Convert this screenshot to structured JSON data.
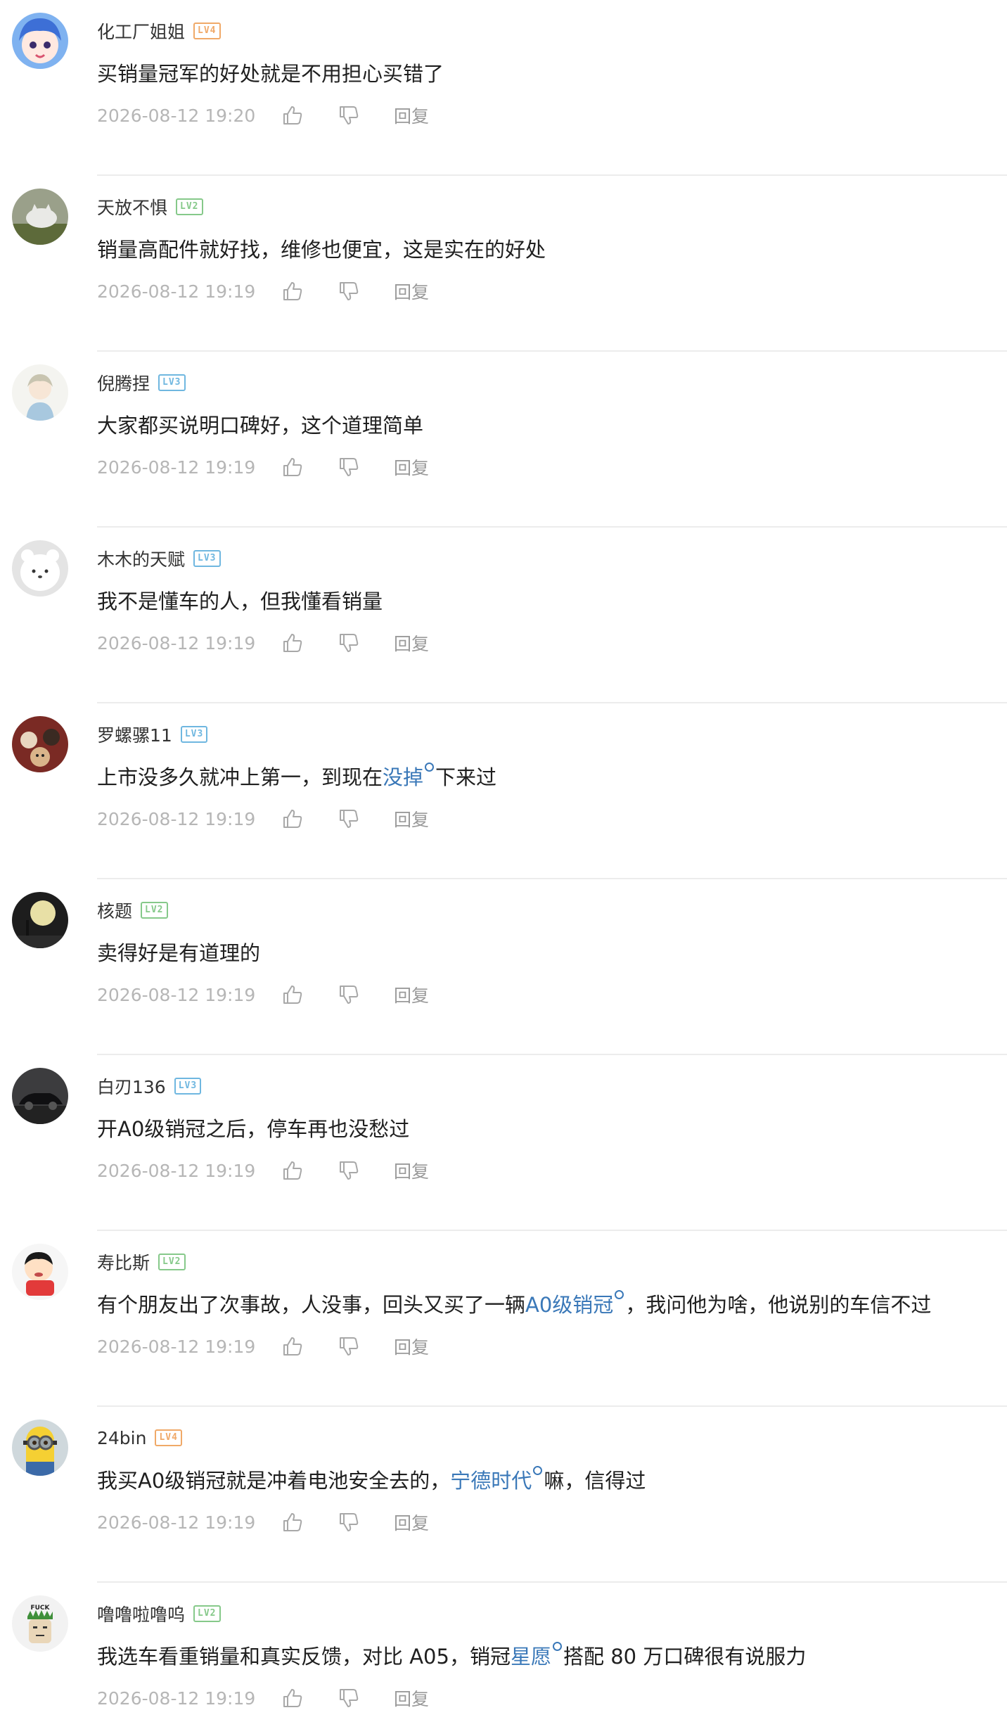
{
  "actions": {
    "reply_label": "回复"
  },
  "colors": {
    "level_orange": "#f0a968",
    "level_green": "#86c98a",
    "level_blue": "#6fb7e0",
    "link": "#3a78b8",
    "meta_gray": "#b6b6b6"
  },
  "comments": [
    {
      "user": "化工厂姐姐",
      "level": "LV4",
      "level_color": "#f0a968",
      "avatar": "anime-girl-avatar",
      "text": [
        "买销量冠军的好处就是不用担心买错了"
      ],
      "time": "2026-08-12 19:20"
    },
    {
      "user": "天放不惧",
      "level": "LV2",
      "level_color": "#86c98a",
      "avatar": "cat-avatar",
      "text": [
        "销量高配件就好找，维修也便宜，这是实在的好处"
      ],
      "time": "2026-08-12 19:19"
    },
    {
      "user": "倪腾捏",
      "level": "LV3",
      "level_color": "#6fb7e0",
      "avatar": "anime-character-avatar",
      "text": [
        "大家都买说明口碑好，这个道理简单"
      ],
      "time": "2026-08-12 19:19"
    },
    {
      "user": "木木的天赋",
      "level": "LV3",
      "level_color": "#6fb7e0",
      "avatar": "white-bear-avatar",
      "text": [
        "我不是懂车的人，但我懂看销量"
      ],
      "time": "2026-08-12 19:19"
    },
    {
      "user": "罗螺骡11",
      "level": "LV3",
      "level_color": "#6fb7e0",
      "avatar": "cats-photo-avatar",
      "text": [
        "上市没多久就冲上第一，到现在",
        "没掉",
        "下来过"
      ],
      "time": "2026-08-12 19:19"
    },
    {
      "user": "核题",
      "level": "LV2",
      "level_color": "#86c98a",
      "avatar": "moon-silhouette-avatar",
      "text": [
        "卖得好是有道理的"
      ],
      "time": "2026-08-12 19:19"
    },
    {
      "user": "白刃136",
      "level": "LV3",
      "level_color": "#6fb7e0",
      "avatar": "car-photo-avatar",
      "text": [
        "开A0级销冠之后，停车再也没愁过"
      ],
      "time": "2026-08-12 19:19"
    },
    {
      "user": "寿比斯",
      "level": "LV2",
      "level_color": "#86c98a",
      "avatar": "cartoon-boy-avatar",
      "text": [
        "有个朋友出了次事故，人没事，回头又买了一辆",
        "A0级销冠",
        "，我问他为啥，他说别的车信不过"
      ],
      "time": "2026-08-12 19:19"
    },
    {
      "user": "24bin",
      "level": "LV4",
      "level_color": "#f0a968",
      "avatar": "minion-avatar",
      "text": [
        "我买A0级销冠就是冲着电池安全去的，",
        "宁德时代",
        "嘛，信得过"
      ],
      "time": "2026-08-12 19:19"
    },
    {
      "user": "噜噜啦噜呜",
      "level": "LV2",
      "level_color": "#86c98a",
      "avatar": "meme-face-avatar",
      "avatar_text": "FUCK",
      "text": [
        "我选车看重销量和真实反馈，对比 A05，销冠",
        "星愿",
        "搭配 80 万口碑很有说服力"
      ],
      "time": "2026-08-12 19:19"
    }
  ]
}
